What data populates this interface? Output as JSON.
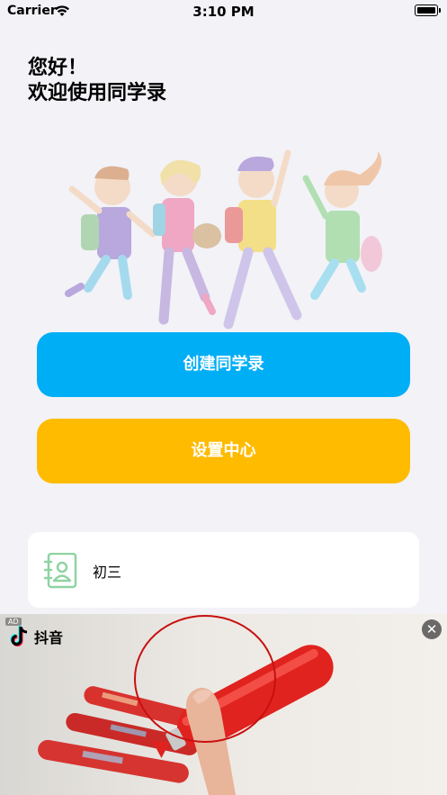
{
  "status_bar": {
    "carrier": "Carrier",
    "time": "3:10 PM",
    "wifi_icon": "wifi-icon",
    "battery_icon": "battery-icon"
  },
  "greeting": {
    "line1": "您好！",
    "line2": "欢迎使用同学录"
  },
  "illustration": {
    "icon": "jumping-students-illustration"
  },
  "buttons": {
    "create_label": "创建同学录",
    "settings_label": "设置中心",
    "create_color": "#00aef6",
    "settings_color": "#ffbb00"
  },
  "records": [
    {
      "label": "初三",
      "icon": "address-book-icon"
    }
  ],
  "ad": {
    "brand": "抖音",
    "tag": "AD",
    "close_icon": "close-icon",
    "logo_icon": "tiktok-logo-icon"
  },
  "colors": {
    "background": "#f2f2f7",
    "accent_green": "#8fd3a3"
  }
}
